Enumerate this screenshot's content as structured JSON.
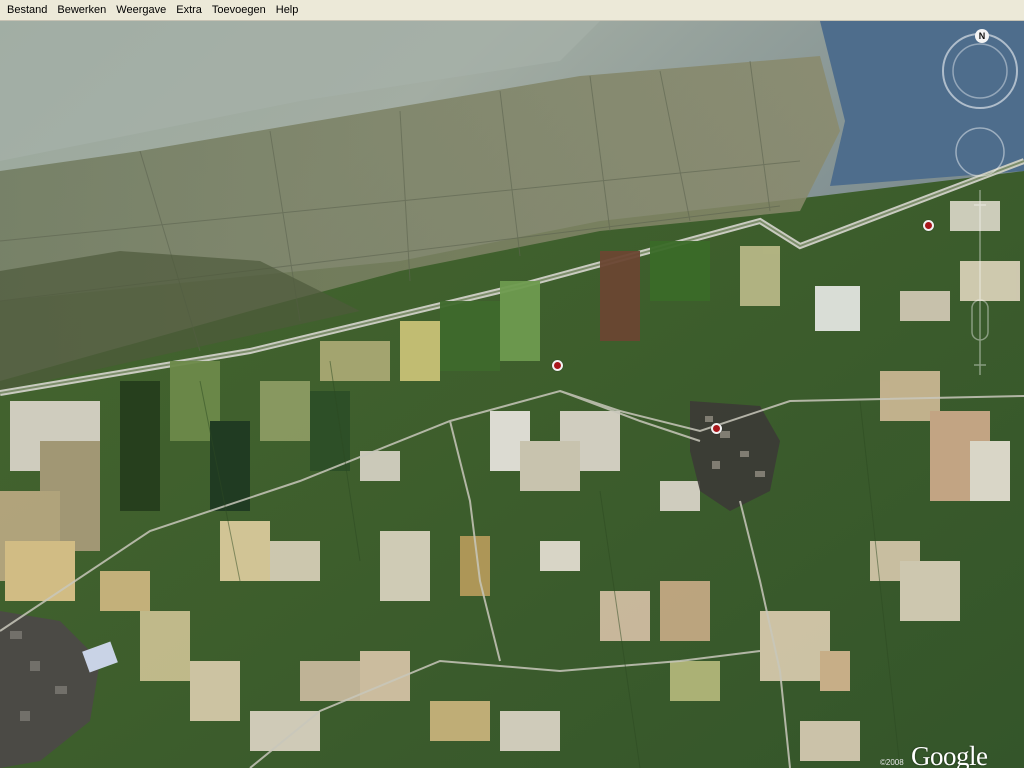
{
  "menu": {
    "items": [
      "Bestand",
      "Bewerken",
      "Weergave",
      "Extra",
      "Toevoegen",
      "Help"
    ]
  },
  "navigation": {
    "north_label": "N",
    "compass_icon": "compass-ring-icon",
    "look_icon": "look-joystick-icon",
    "zoom_icon": "zoom-slider-icon"
  },
  "attribution": {
    "copyright": "©2008",
    "brand": "Google"
  },
  "colors": {
    "menubar_bg": "#ece9d8",
    "placemark": "#a8171c",
    "mudflat": "#8f9e92",
    "sea": "#4f6f8f",
    "field_green": "#3f6a2c"
  }
}
